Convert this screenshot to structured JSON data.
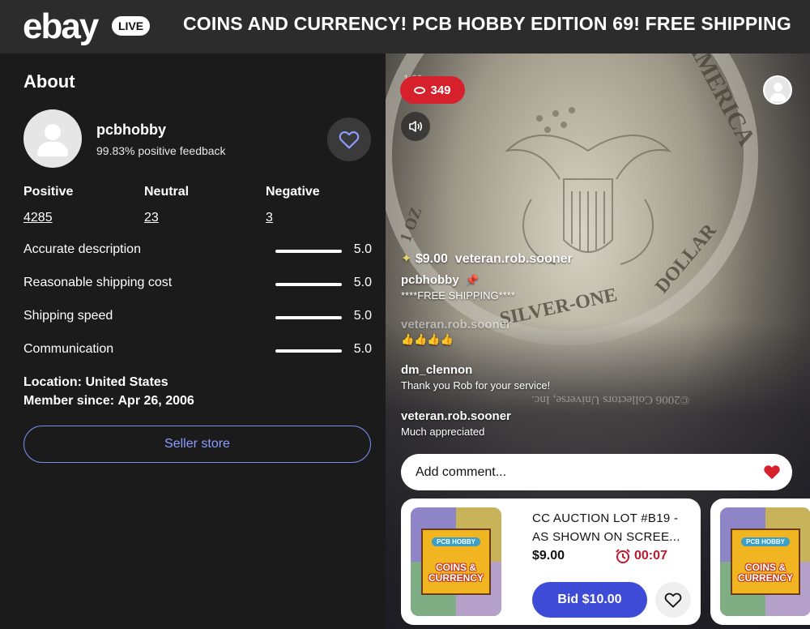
{
  "header": {
    "logo": "ebay",
    "live_badge": "LIVE",
    "title": "COINS AND CURRENCY! PCB HOBBY EDITION 69! FREE SHIPPING"
  },
  "about": {
    "heading": "About",
    "seller_name": "pcbhobby",
    "feedback": "99.83% positive feedback",
    "stats": [
      {
        "label": "Positive",
        "value": "4285"
      },
      {
        "label": "Neutral",
        "value": "23"
      },
      {
        "label": "Negative",
        "value": "3"
      }
    ],
    "ratings": [
      {
        "label": "Accurate description",
        "value": "5.0",
        "score": 5.0
      },
      {
        "label": "Reasonable shipping cost",
        "value": "5.0",
        "score": 5.0
      },
      {
        "label": "Shipping speed",
        "value": "5.0",
        "score": 5.0
      },
      {
        "label": "Communication",
        "value": "5.0",
        "score": 5.0
      }
    ],
    "location_label": "Location:",
    "location_value": "United States",
    "member_label": "Member since:",
    "member_value": "Apr 26, 2006",
    "store_button": "Seller store"
  },
  "stream": {
    "zoom": "1.00",
    "viewer_count": "349",
    "coin_texts": {
      "america": "AMERICA",
      "dollar": "DOLLAR",
      "silver": "SILVER-ONE",
      "oz": "1 OZ",
      "copyright": "©2006 Collectors Universe, Inc."
    },
    "last_bid": {
      "amount": "$9.00",
      "bidder": "veteran.rob.sooner"
    },
    "pinned": {
      "name": "pcbhobby",
      "message": "****FREE SHIPPING****"
    },
    "chat": [
      {
        "name": "veteran.rob.sooner",
        "message": "👍👍👍👍"
      },
      {
        "name": "dm_clennon",
        "message": "Thank you Rob for your service!"
      },
      {
        "name": "veteran.rob.sooner",
        "message": "Much appreciated"
      }
    ],
    "comment_placeholder": "Add comment...",
    "colors": {
      "viewer_badge": "#d6202c",
      "bid_button": "#3e4bd6",
      "timer": "#c0182e",
      "heart": "#d6202c"
    }
  },
  "auction": {
    "thumb_badge_top": "PCB HOBBY",
    "thumb_badge_main": "COINS & CURRENCY",
    "title": "CC AUCTION LOT #B19 - AS SHOWN ON SCREE...",
    "price": "$9.00",
    "timer": "00:07",
    "bid_button": "Bid  $10.00"
  }
}
